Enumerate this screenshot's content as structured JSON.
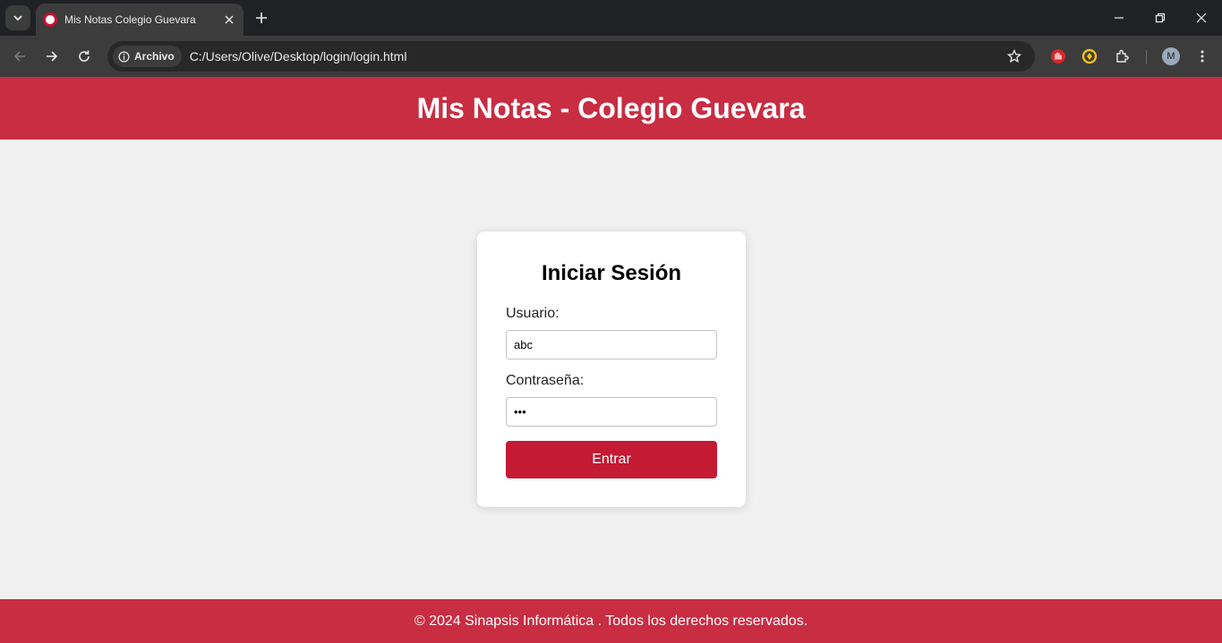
{
  "browser": {
    "tab": {
      "title": "Mis Notas Colegio Guevara"
    },
    "omnibox": {
      "chip_label": "Archivo",
      "url": "C:/Users/Olive/Desktop/login/login.html"
    },
    "profile_initial": "M",
    "icons": {
      "tab_list": "chevron-down-icon",
      "tab_close": "close-icon",
      "new_tab": "plus-icon",
      "minimize": "minimize-icon",
      "restore": "restore-icon",
      "close": "close-icon",
      "back": "arrow-left-icon",
      "forward": "arrow-right-icon",
      "reload": "reload-icon",
      "info": "info-icon",
      "bookmark": "star-icon",
      "extension_1": "red-hand-extension-icon",
      "extension_2": "yellow-circle-extension-icon",
      "extensions": "puzzle-icon",
      "menu": "kebab-menu-icon"
    }
  },
  "page": {
    "header": {
      "title": "Mis Notas - Colegio Guevara"
    },
    "login": {
      "heading": "Iniciar Sesión",
      "username_label": "Usuario:",
      "username_value": "abc",
      "password_label": "Contraseña:",
      "password_value": "abc",
      "submit_label": "Entrar"
    },
    "footer": {
      "text": "© 2024 Sinapsis Informática . Todos los derechos reservados."
    },
    "colors": {
      "brand": "#c82d42",
      "button": "#c41a33",
      "background": "#f0f0f0",
      "card": "#ffffff"
    }
  }
}
